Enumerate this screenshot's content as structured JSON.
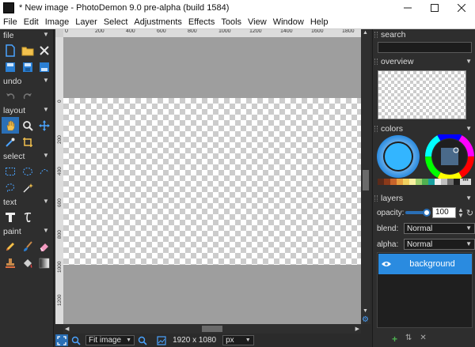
{
  "window": {
    "title": "* New image  -  PhotoDemon 9.0 pre-alpha (build 1584)",
    "controls": [
      "minimize-icon",
      "maximize-icon",
      "close-icon"
    ]
  },
  "menu": [
    "File",
    "Edit",
    "Image",
    "Layer",
    "Select",
    "Adjustments",
    "Effects",
    "Tools",
    "View",
    "Window",
    "Help"
  ],
  "toolbox": {
    "sections": {
      "file": "file",
      "undo": "undo",
      "layout": "layout",
      "select": "select",
      "text": "text",
      "paint": "paint"
    }
  },
  "rulers": {
    "top": [
      "0",
      "200",
      "400",
      "600",
      "800",
      "1000",
      "1200",
      "1400",
      "1600",
      "1800"
    ],
    "left": [
      "0",
      "200",
      "400",
      "600",
      "800",
      "1000",
      "1200"
    ]
  },
  "statusbar": {
    "zoom_value": "Fit image",
    "image_size": "1920 x 1080",
    "unit_value": "px"
  },
  "right_panel": {
    "search_title": "search",
    "overview_title": "overview",
    "colors_title": "colors",
    "primary_color": "#33b5ff",
    "palette": [
      "#5a2a1a",
      "#8b3a1a",
      "#c8642a",
      "#e8a040",
      "#f0d060",
      "#f8f0a0",
      "#a0d070",
      "#50b050",
      "#1aa0a0",
      "#f0f0f0",
      "#c0c0c0",
      "#707070",
      "#202020"
    ],
    "more_label": "•••",
    "layers_title": "layers",
    "opacity_label": "opacity:",
    "opacity_value": "100",
    "blend_label": "blend:",
    "blend_value": "Normal",
    "alpha_label": "alpha:",
    "alpha_value": "Normal",
    "layers": [
      {
        "name": "background",
        "visible": true,
        "selected": true
      }
    ]
  }
}
